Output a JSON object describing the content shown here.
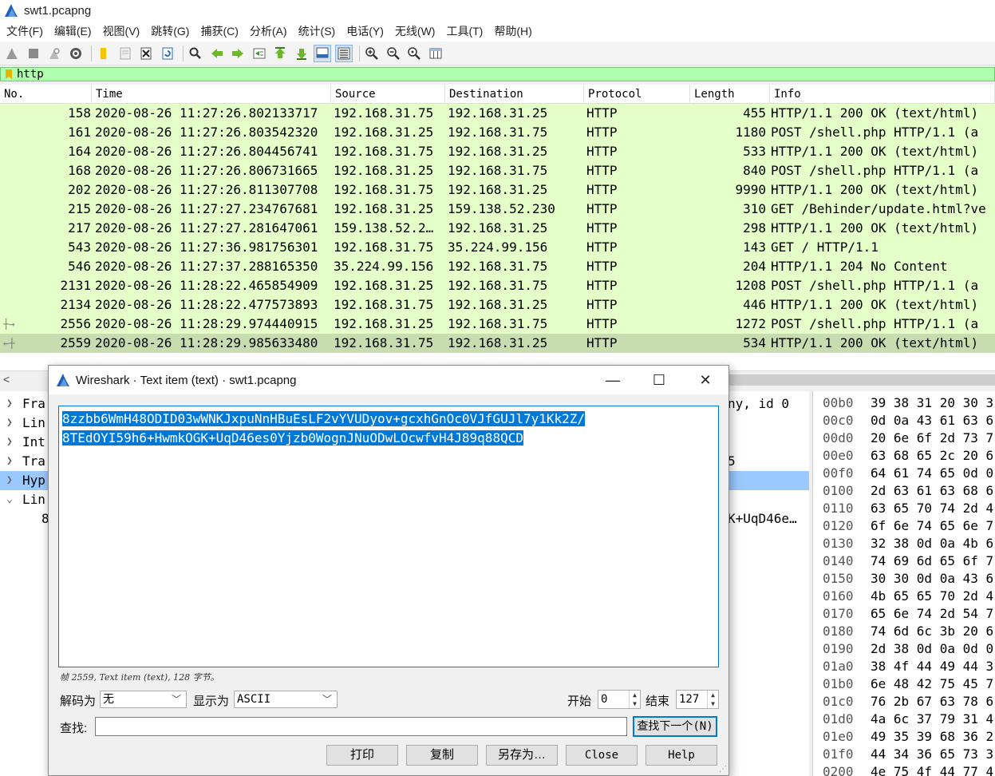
{
  "window": {
    "title": "swt1.pcapng"
  },
  "menu": [
    "文件(F)",
    "编辑(E)",
    "视图(V)",
    "跳转(G)",
    "捕获(C)",
    "分析(A)",
    "统计(S)",
    "电话(Y)",
    "无线(W)",
    "工具(T)",
    "帮助(H)"
  ],
  "filter": {
    "value": "http"
  },
  "columns": [
    "No.",
    "Time",
    "Source",
    "Destination",
    "Protocol",
    "Length",
    "Info"
  ],
  "packets": [
    {
      "no": "158",
      "time": "2020-08-26 11:27:26.802133717",
      "src": "192.168.31.75",
      "dst": "192.168.31.25",
      "proto": "HTTP",
      "len": "455",
      "info": "HTTP/1.1 200 OK  (text/html)"
    },
    {
      "no": "161",
      "time": "2020-08-26 11:27:26.803542320",
      "src": "192.168.31.25",
      "dst": "192.168.31.75",
      "proto": "HTTP",
      "len": "1180",
      "info": "POST /shell.php HTTP/1.1  (a"
    },
    {
      "no": "164",
      "time": "2020-08-26 11:27:26.804456741",
      "src": "192.168.31.75",
      "dst": "192.168.31.25",
      "proto": "HTTP",
      "len": "533",
      "info": "HTTP/1.1 200 OK  (text/html)"
    },
    {
      "no": "168",
      "time": "2020-08-26 11:27:26.806731665",
      "src": "192.168.31.25",
      "dst": "192.168.31.75",
      "proto": "HTTP",
      "len": "840",
      "info": "POST /shell.php HTTP/1.1  (a"
    },
    {
      "no": "202",
      "time": "2020-08-26 11:27:26.811307708",
      "src": "192.168.31.75",
      "dst": "192.168.31.25",
      "proto": "HTTP",
      "len": "9990",
      "info": "HTTP/1.1 200 OK  (text/html)"
    },
    {
      "no": "215",
      "time": "2020-08-26 11:27:27.234767681",
      "src": "192.168.31.25",
      "dst": "159.138.52.230",
      "proto": "HTTP",
      "len": "310",
      "info": "GET /Behinder/update.html?ve"
    },
    {
      "no": "217",
      "time": "2020-08-26 11:27:27.281647061",
      "src": "159.138.52.2…",
      "dst": "192.168.31.25",
      "proto": "HTTP",
      "len": "298",
      "info": "HTTP/1.1 200 OK  (text/html)"
    },
    {
      "no": "543",
      "time": "2020-08-26 11:27:36.981756301",
      "src": "192.168.31.75",
      "dst": "35.224.99.156",
      "proto": "HTTP",
      "len": "143",
      "info": "GET / HTTP/1.1"
    },
    {
      "no": "546",
      "time": "2020-08-26 11:27:37.288165350",
      "src": "35.224.99.156",
      "dst": "192.168.31.75",
      "proto": "HTTP",
      "len": "204",
      "info": "HTTP/1.1 204 No Content"
    },
    {
      "no": "2131",
      "time": "2020-08-26 11:28:22.465854909",
      "src": "192.168.31.25",
      "dst": "192.168.31.75",
      "proto": "HTTP",
      "len": "1208",
      "info": "POST /shell.php HTTP/1.1  (a"
    },
    {
      "no": "2134",
      "time": "2020-08-26 11:28:22.477573893",
      "src": "192.168.31.75",
      "dst": "192.168.31.25",
      "proto": "HTTP",
      "len": "446",
      "info": "HTTP/1.1 200 OK  (text/html)"
    },
    {
      "no": "2556",
      "time": "2020-08-26 11:28:29.974440915",
      "src": "192.168.31.25",
      "dst": "192.168.31.75",
      "proto": "HTTP",
      "len": "1272",
      "info": "POST /shell.php HTTP/1.1  (a"
    },
    {
      "no": "2559",
      "time": "2020-08-26 11:28:29.985633480",
      "src": "192.168.31.75",
      "dst": "192.168.31.25",
      "proto": "HTTP",
      "len": "534",
      "info": "HTTP/1.1 200 OK  (text/html)"
    }
  ],
  "details": {
    "rows": [
      {
        "label": "Fra",
        "right": "ny, id 0"
      },
      {
        "label": "Lin",
        "right": ""
      },
      {
        "label": "Int",
        "right": ""
      },
      {
        "label": "Tra",
        "right": "5"
      },
      {
        "label": "Hyp",
        "right": ""
      },
      {
        "label": "Lin",
        "right": ""
      },
      {
        "label": "8",
        "right": "K+UqD46e…"
      }
    ]
  },
  "hex": [
    {
      "off": "00b0",
      "bytes": "39 38 31 20 30 3"
    },
    {
      "off": "00c0",
      "bytes": "0d 0a 43 61 63 6"
    },
    {
      "off": "00d0",
      "bytes": "20 6e 6f 2d 73 7"
    },
    {
      "off": "00e0",
      "bytes": "63 68 65 2c 20 6"
    },
    {
      "off": "00f0",
      "bytes": "64 61 74 65 0d 0"
    },
    {
      "off": "0100",
      "bytes": "2d 63 61 63 68 6"
    },
    {
      "off": "0110",
      "bytes": "63 65 70 74 2d 4"
    },
    {
      "off": "0120",
      "bytes": "6f 6e 74 65 6e 7"
    },
    {
      "off": "0130",
      "bytes": "32 38 0d 0a 4b 6"
    },
    {
      "off": "0140",
      "bytes": "74 69 6d 65 6f 7"
    },
    {
      "off": "0150",
      "bytes": "30 30 0d 0a 43 6"
    },
    {
      "off": "0160",
      "bytes": "4b 65 65 70 2d 4"
    },
    {
      "off": "0170",
      "bytes": "65 6e 74 2d 54 7"
    },
    {
      "off": "0180",
      "bytes": "74 6d 6c 3b 20 6"
    },
    {
      "off": "0190",
      "bytes": "2d 38 0d 0a 0d 0"
    },
    {
      "off": "01a0",
      "bytes": "38 4f 44 49 44 3"
    },
    {
      "off": "01b0",
      "bytes": "6e 48 42 75 45 7"
    },
    {
      "off": "01c0",
      "bytes": "76 2b 67 63 78 6"
    },
    {
      "off": "01d0",
      "bytes": "4a 6c 37 79 31 4"
    },
    {
      "off": "01e0",
      "bytes": "49 35 39 68 36 2"
    },
    {
      "off": "01f0",
      "bytes": "44 34 36 65 73 3"
    },
    {
      "off": "0200",
      "bytes": "4e 75 4f 44 77 4"
    }
  ],
  "dialog": {
    "title": "Wireshark · Text item (text) · swt1.pcapng",
    "text_line1": "8zzbb6WmH48ODID03wWNKJxpuNnHBuEsLF2vYVUDyov+gcxhGnOc0VJfGUJl7y1Kk2Z/",
    "text_line2": "8TEdOYI59h6+HwmkOGK+UqD46es0Yjzb0WognJNuODwLOcwfvH4J89q88QCD",
    "status": "帧 2559, Text item (text), 128 字节。",
    "decode_label": "解码为",
    "decode_value": "无",
    "show_label": "显示为",
    "show_value": "ASCII",
    "start_label": "开始",
    "start_value": "0",
    "end_label": "结束",
    "end_value": "127",
    "find_label": "查找:",
    "find_placeholder": "",
    "find_next": "查找下一个(N)",
    "btn_print": "打印",
    "btn_copy": "复制",
    "btn_saveas": "另存为…",
    "btn_close": "Close",
    "btn_help": "Help"
  },
  "colors": {
    "http_row": "#e4ffc7",
    "filter_ok": "#afffaf",
    "selection": "#0078d7"
  }
}
